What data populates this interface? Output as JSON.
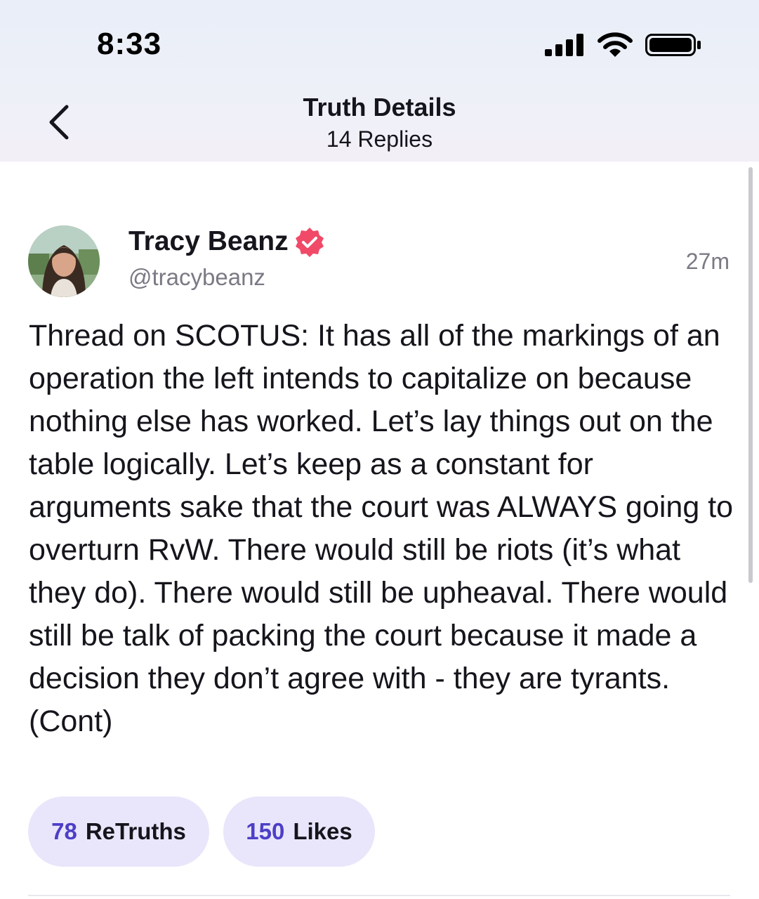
{
  "status_bar": {
    "time": "8:33",
    "icons": [
      "signal-icon",
      "wifi-icon",
      "battery-icon"
    ]
  },
  "header": {
    "title": "Truth Details",
    "subtitle": "14 Replies",
    "back_icon": "chevron-left-icon"
  },
  "post": {
    "author": {
      "display_name": "Tracy Beanz",
      "handle": "@tracybeanz",
      "verified": true
    },
    "time_ago": "27m",
    "body": "Thread on SCOTUS: It has all of the markings of an operation the left intends to capitalize on because nothing else has worked. Let’s lay things out on the table logically. Let’s keep as a constant for arguments sake that the court was ALWAYS going to overturn RvW. There would still be riots (it’s what they do). There would still be upheaval. There would still be talk of packing the court because it made a decision they don’t agree with - they are tyrants. (Cont)",
    "stats": {
      "retruths_count": "78",
      "retruths_label": "ReTruths",
      "likes_count": "150",
      "likes_label": "Likes"
    }
  },
  "colors": {
    "accent": "#4d3fc6",
    "pill_bg": "#e9e6fb",
    "verified_badge": "#f04a68",
    "muted_text": "#7a7a85"
  }
}
